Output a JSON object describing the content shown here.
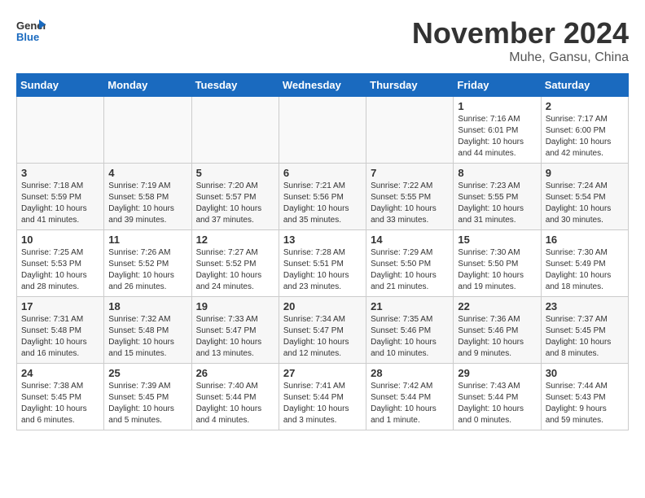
{
  "header": {
    "logo_text_general": "General",
    "logo_text_blue": "Blue",
    "month_title": "November 2024",
    "location": "Muhe, Gansu, China"
  },
  "weekdays": [
    "Sunday",
    "Monday",
    "Tuesday",
    "Wednesday",
    "Thursday",
    "Friday",
    "Saturday"
  ],
  "weeks": [
    [
      {
        "day": "",
        "info": ""
      },
      {
        "day": "",
        "info": ""
      },
      {
        "day": "",
        "info": ""
      },
      {
        "day": "",
        "info": ""
      },
      {
        "day": "",
        "info": ""
      },
      {
        "day": "1",
        "info": "Sunrise: 7:16 AM\nSunset: 6:01 PM\nDaylight: 10 hours\nand 44 minutes."
      },
      {
        "day": "2",
        "info": "Sunrise: 7:17 AM\nSunset: 6:00 PM\nDaylight: 10 hours\nand 42 minutes."
      }
    ],
    [
      {
        "day": "3",
        "info": "Sunrise: 7:18 AM\nSunset: 5:59 PM\nDaylight: 10 hours\nand 41 minutes."
      },
      {
        "day": "4",
        "info": "Sunrise: 7:19 AM\nSunset: 5:58 PM\nDaylight: 10 hours\nand 39 minutes."
      },
      {
        "day": "5",
        "info": "Sunrise: 7:20 AM\nSunset: 5:57 PM\nDaylight: 10 hours\nand 37 minutes."
      },
      {
        "day": "6",
        "info": "Sunrise: 7:21 AM\nSunset: 5:56 PM\nDaylight: 10 hours\nand 35 minutes."
      },
      {
        "day": "7",
        "info": "Sunrise: 7:22 AM\nSunset: 5:55 PM\nDaylight: 10 hours\nand 33 minutes."
      },
      {
        "day": "8",
        "info": "Sunrise: 7:23 AM\nSunset: 5:55 PM\nDaylight: 10 hours\nand 31 minutes."
      },
      {
        "day": "9",
        "info": "Sunrise: 7:24 AM\nSunset: 5:54 PM\nDaylight: 10 hours\nand 30 minutes."
      }
    ],
    [
      {
        "day": "10",
        "info": "Sunrise: 7:25 AM\nSunset: 5:53 PM\nDaylight: 10 hours\nand 28 minutes."
      },
      {
        "day": "11",
        "info": "Sunrise: 7:26 AM\nSunset: 5:52 PM\nDaylight: 10 hours\nand 26 minutes."
      },
      {
        "day": "12",
        "info": "Sunrise: 7:27 AM\nSunset: 5:52 PM\nDaylight: 10 hours\nand 24 minutes."
      },
      {
        "day": "13",
        "info": "Sunrise: 7:28 AM\nSunset: 5:51 PM\nDaylight: 10 hours\nand 23 minutes."
      },
      {
        "day": "14",
        "info": "Sunrise: 7:29 AM\nSunset: 5:50 PM\nDaylight: 10 hours\nand 21 minutes."
      },
      {
        "day": "15",
        "info": "Sunrise: 7:30 AM\nSunset: 5:50 PM\nDaylight: 10 hours\nand 19 minutes."
      },
      {
        "day": "16",
        "info": "Sunrise: 7:30 AM\nSunset: 5:49 PM\nDaylight: 10 hours\nand 18 minutes."
      }
    ],
    [
      {
        "day": "17",
        "info": "Sunrise: 7:31 AM\nSunset: 5:48 PM\nDaylight: 10 hours\nand 16 minutes."
      },
      {
        "day": "18",
        "info": "Sunrise: 7:32 AM\nSunset: 5:48 PM\nDaylight: 10 hours\nand 15 minutes."
      },
      {
        "day": "19",
        "info": "Sunrise: 7:33 AM\nSunset: 5:47 PM\nDaylight: 10 hours\nand 13 minutes."
      },
      {
        "day": "20",
        "info": "Sunrise: 7:34 AM\nSunset: 5:47 PM\nDaylight: 10 hours\nand 12 minutes."
      },
      {
        "day": "21",
        "info": "Sunrise: 7:35 AM\nSunset: 5:46 PM\nDaylight: 10 hours\nand 10 minutes."
      },
      {
        "day": "22",
        "info": "Sunrise: 7:36 AM\nSunset: 5:46 PM\nDaylight: 10 hours\nand 9 minutes."
      },
      {
        "day": "23",
        "info": "Sunrise: 7:37 AM\nSunset: 5:45 PM\nDaylight: 10 hours\nand 8 minutes."
      }
    ],
    [
      {
        "day": "24",
        "info": "Sunrise: 7:38 AM\nSunset: 5:45 PM\nDaylight: 10 hours\nand 6 minutes."
      },
      {
        "day": "25",
        "info": "Sunrise: 7:39 AM\nSunset: 5:45 PM\nDaylight: 10 hours\nand 5 minutes."
      },
      {
        "day": "26",
        "info": "Sunrise: 7:40 AM\nSunset: 5:44 PM\nDaylight: 10 hours\nand 4 minutes."
      },
      {
        "day": "27",
        "info": "Sunrise: 7:41 AM\nSunset: 5:44 PM\nDaylight: 10 hours\nand 3 minutes."
      },
      {
        "day": "28",
        "info": "Sunrise: 7:42 AM\nSunset: 5:44 PM\nDaylight: 10 hours\nand 1 minute."
      },
      {
        "day": "29",
        "info": "Sunrise: 7:43 AM\nSunset: 5:44 PM\nDaylight: 10 hours\nand 0 minutes."
      },
      {
        "day": "30",
        "info": "Sunrise: 7:44 AM\nSunset: 5:43 PM\nDaylight: 9 hours\nand 59 minutes."
      }
    ]
  ]
}
